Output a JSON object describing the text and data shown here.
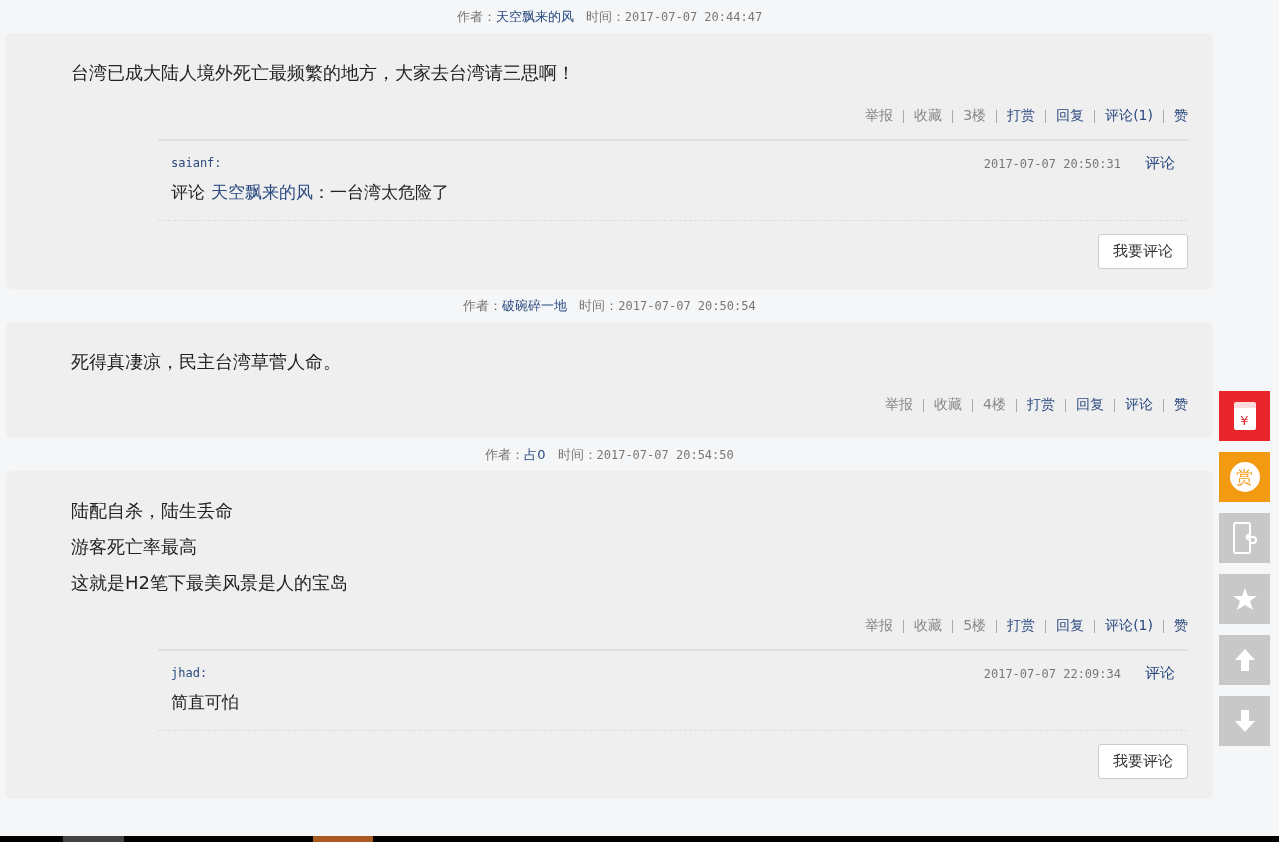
{
  "posts": [
    {
      "author_label": "作者：",
      "author": "天空飘来的风",
      "time_label": "时间：",
      "time": "2017-07-07 20:44:47",
      "body": [
        "台湾已成大陆人境外死亡最频繁的地方，大家去台湾请三思啊！"
      ],
      "actions": [
        {
          "label": "举报",
          "kind": "plain"
        },
        {
          "label": "收藏",
          "kind": "plain"
        },
        {
          "label": "3楼",
          "kind": "plain"
        },
        {
          "label": "打赏",
          "kind": "link"
        },
        {
          "label": "回复",
          "kind": "link"
        },
        {
          "label": "评论(1)",
          "kind": "link"
        },
        {
          "label": "赞",
          "kind": "link"
        }
      ],
      "comments": [
        {
          "user": "saianf:",
          "prefix": "评论",
          "target": "天空飘来的风",
          "text": "：一台湾太危险了",
          "time": "2017-07-07 20:50:31",
          "reply": "评论"
        }
      ],
      "comment_button": "我要评论"
    },
    {
      "author_label": "作者：",
      "author": "破碗碎一地",
      "time_label": "时间：",
      "time": "2017-07-07 20:50:54",
      "body": [
        "死得真凄凉，民主台湾草菅人命。"
      ],
      "actions": [
        {
          "label": "举报",
          "kind": "plain"
        },
        {
          "label": "收藏",
          "kind": "plain"
        },
        {
          "label": "4楼",
          "kind": "plain"
        },
        {
          "label": "打赏",
          "kind": "link"
        },
        {
          "label": "回复",
          "kind": "link"
        },
        {
          "label": "评论",
          "kind": "link"
        },
        {
          "label": "赞",
          "kind": "link"
        }
      ]
    },
    {
      "author_label": "作者：",
      "author": "占0",
      "time_label": "时间：",
      "time": "2017-07-07 20:54:50",
      "body": [
        "陆配自杀，陆生丢命",
        "游客死亡率最高",
        "这就是H2笔下最美风景是人的宝岛"
      ],
      "actions": [
        {
          "label": "举报",
          "kind": "plain"
        },
        {
          "label": "收藏",
          "kind": "plain"
        },
        {
          "label": "5楼",
          "kind": "plain"
        },
        {
          "label": "打赏",
          "kind": "link"
        },
        {
          "label": "回复",
          "kind": "link"
        },
        {
          "label": "评论(1)",
          "kind": "link"
        },
        {
          "label": "赞",
          "kind": "link"
        }
      ],
      "comments": [
        {
          "user": "jhad:",
          "text": "简直可怕",
          "time": "2017-07-07 22:09:34",
          "reply": "评论"
        }
      ],
      "comment_button": "我要评论"
    }
  ],
  "side_buttons": [
    {
      "kind": "red-packet",
      "glyph": "¥"
    },
    {
      "kind": "reward",
      "glyph": "赏"
    },
    {
      "kind": "phone"
    },
    {
      "kind": "star"
    },
    {
      "kind": "up"
    },
    {
      "kind": "down"
    }
  ]
}
